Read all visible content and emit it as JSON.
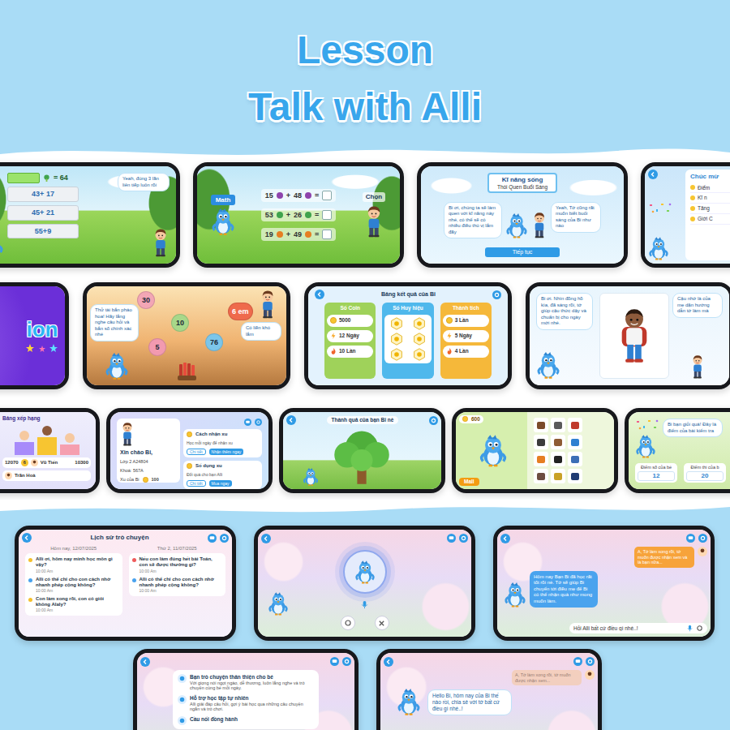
{
  "header": {
    "line1": "Lesson",
    "line2": "Talk with Alli"
  },
  "rows": [
    {
      "screens": [
        {
          "kind": "quiz",
          "target": "= 64",
          "bubble": "Yeah, đúng 3 lần liên tiếp luôn rồi",
          "options": [
            "43+ 17",
            "45+ 21",
            "55+9"
          ]
        },
        {
          "kind": "sums",
          "subject": "Math",
          "action": "Chọn",
          "sums": [
            {
              "a": "15",
              "op": "+",
              "b": "48",
              "eq": "=",
              "color": "#8e44ad"
            },
            {
              "a": "53",
              "op": "+",
              "b": "26",
              "eq": "=",
              "color": "#3fa34d"
            },
            {
              "a": "19",
              "op": "+",
              "b": "49",
              "eq": "=",
              "color": "#e67e22"
            }
          ]
        },
        {
          "kind": "skill",
          "heading": "Kĩ năng sống",
          "topic": "Thói Quen Buổi Sáng",
          "bubble_left": "Bi ơi, chúng ta sẽ làm quen với kĩ năng này nhé, có thể sẽ có nhiều điều thú vị lắm đấy",
          "bubble_right": "Yeah, Tớ cũng rất muốn biết buổi sáng của Bi như nào",
          "button": "Tiếp tục"
        },
        {
          "kind": "congrats",
          "heading": "Chúc mừ",
          "items": [
            "Điểm",
            "Kĩ n",
            "Tăng",
            "Giới C"
          ]
        }
      ]
    },
    {
      "screens": [
        {
          "kind": "splash",
          "word": "ion"
        },
        {
          "kind": "fireworks",
          "bubble": "Thử tài bắn pháo hoa! Hãy lắng nghe câu hỏi và bắn số chính xác nhé",
          "reply": "Có liền khó lắm",
          "targets": [
            {
              "label": "30",
              "color": "#f3a6b5"
            },
            {
              "label": "10",
              "color": "#a8d88a"
            },
            {
              "label": "5",
              "color": "#f29ab0"
            },
            {
              "label": "76",
              "color": "#7cc6ea"
            },
            {
              "label": "6 em",
              "color": "#ef6a4c"
            }
          ]
        },
        {
          "kind": "results",
          "title": "Bảng kết quả của Bi",
          "columns": [
            {
              "kind": "list",
              "heading": "Số Coin",
              "color": "#9fd25a",
              "rows": [
                "5000",
                "12 Ngày",
                "10 Lần"
              ]
            },
            {
              "kind": "badges",
              "heading": "Số Huy hiệu",
              "color": "#4fb8ec"
            },
            {
              "kind": "list",
              "heading": "Thành tích",
              "color": "#f5b83a",
              "rows": [
                "3 Lần",
                "5 Ngày",
                "4 Lần"
              ]
            }
          ]
        },
        {
          "kind": "story",
          "bubble_left": "Bi ơi. Nhìn đồng hồ kìa, đã sáng rồi, tớ giúp cậu thức dậy và chuẩn bị cho ngày mới nhé.",
          "bubble_right": "Cậu nhớ là của mẹ dặn hướng dẫn tớ làm mà"
        }
      ]
    },
    {
      "screens": [
        {
          "kind": "leaderboard",
          "heading": "Bảng xếp hạng",
          "rows": [
            {
              "score": "12070",
              "rank": "6",
              "name": "Vũ Tiến",
              "points": "10300"
            }
          ],
          "next_name": "Trần Hoà"
        },
        {
          "kind": "profile",
          "greeting": "Xin chào Bi,",
          "class_line": "Lớp 2 A24804",
          "course_line": "Khoá: 567A",
          "coins_label": "Xu của Bi",
          "coins": "100",
          "cards": [
            {
              "title": "Cách nhận xu",
              "note": "Học mỗi ngày để nhận xu",
              "buttons": [
                "Chi tiết",
                "Nhận thêm ngay"
              ]
            },
            {
              "title": "Số dụng xu",
              "note": "Đổi quà cho bạn Alli",
              "buttons": [
                "Chi tiết",
                "Mua ngay"
              ]
            }
          ]
        },
        {
          "kind": "tree",
          "title": "Thành quả của bạn Bi nè"
        },
        {
          "kind": "shop",
          "coins": "600",
          "button": "Mall"
        },
        {
          "kind": "score",
          "bubble": "Bi bạn giỏi quá! Đây là điểm của bài kiểm tra",
          "cards": [
            {
              "label": "Điểm số của bé",
              "value": "12"
            },
            {
              "label": "Điểm thi của b",
              "value": "20"
            }
          ]
        }
      ]
    },
    {
      "screens": [
        {
          "kind": "history",
          "title": "Lịch sử trò chuyện",
          "days": [
            {
              "date": "Hôm nay, 12/07/2025",
              "messages": [
                {
                  "text": "Alli ơi, hôm nay mình học môn gì vậy?",
                  "time": "10:00 Am",
                  "color": "#f5c02e"
                },
                {
                  "text": "Alli có thể chỉ cho con cách nhớ nhanh phép cộng không?",
                  "time": "10:00 Am",
                  "color": "#4aa3ee"
                },
                {
                  "text": "Con làm xong rồi, con có giỏi không Alaly?",
                  "time": "10:00 Am",
                  "color": "#f5c02e"
                }
              ]
            },
            {
              "date": "Thứ 2, 11/07/2025",
              "messages": [
                {
                  "text": "Nếu con làm đúng hết bài Toán, con sẽ được thưởng gì?",
                  "time": "10:00 Am",
                  "color": "#ef5b5b"
                },
                {
                  "text": "Alli có thể chỉ cho con cách nhớ nhanh phép cộng không?",
                  "time": "10:00 Am",
                  "color": "#4aa3ee"
                }
              ]
            }
          ]
        },
        {
          "kind": "voice"
        },
        {
          "kind": "chat",
          "kid_message": "A, Tớ làm xong rồi, tớ muốn được nhận xem và là bạn nữa...",
          "alli_message": "Hôm nay Bạn Bi đã học rất tốt rồi nè. Tớ sẽ giúp Bi chuyển tới điều mẹ để Bi có thể nhận quà như mong muốn làm.",
          "placeholder": "Hỏi Alli bất cứ điều gì nhé..!"
        }
      ]
    },
    {
      "screens": [
        {
          "kind": "features",
          "items": [
            {
              "title": "Bạn trò chuyện thân thiện cho bé",
              "text": "Với giọng nói ngọt ngào, dễ thương, luôn lắng nghe và trò chuyện cùng bé mỗi ngày."
            },
            {
              "title": "Hỗ trợ học tập tự nhiên",
              "text": "Alli giải đáp câu hỏi, gợi ý bài học qua những câu chuyện ngắn và trò chơi."
            },
            {
              "title": "Cầu nối đồng hành"
            }
          ]
        },
        {
          "kind": "greeting",
          "faded_message": "A, Tớ làm xong rồi, tớ muốn được nhận xem...",
          "bubble": "Hello Bi, hôm nay của Bi thế nào rồi, chia sẻ với tớ bất cứ điều gì nhé..!"
        }
      ]
    }
  ]
}
